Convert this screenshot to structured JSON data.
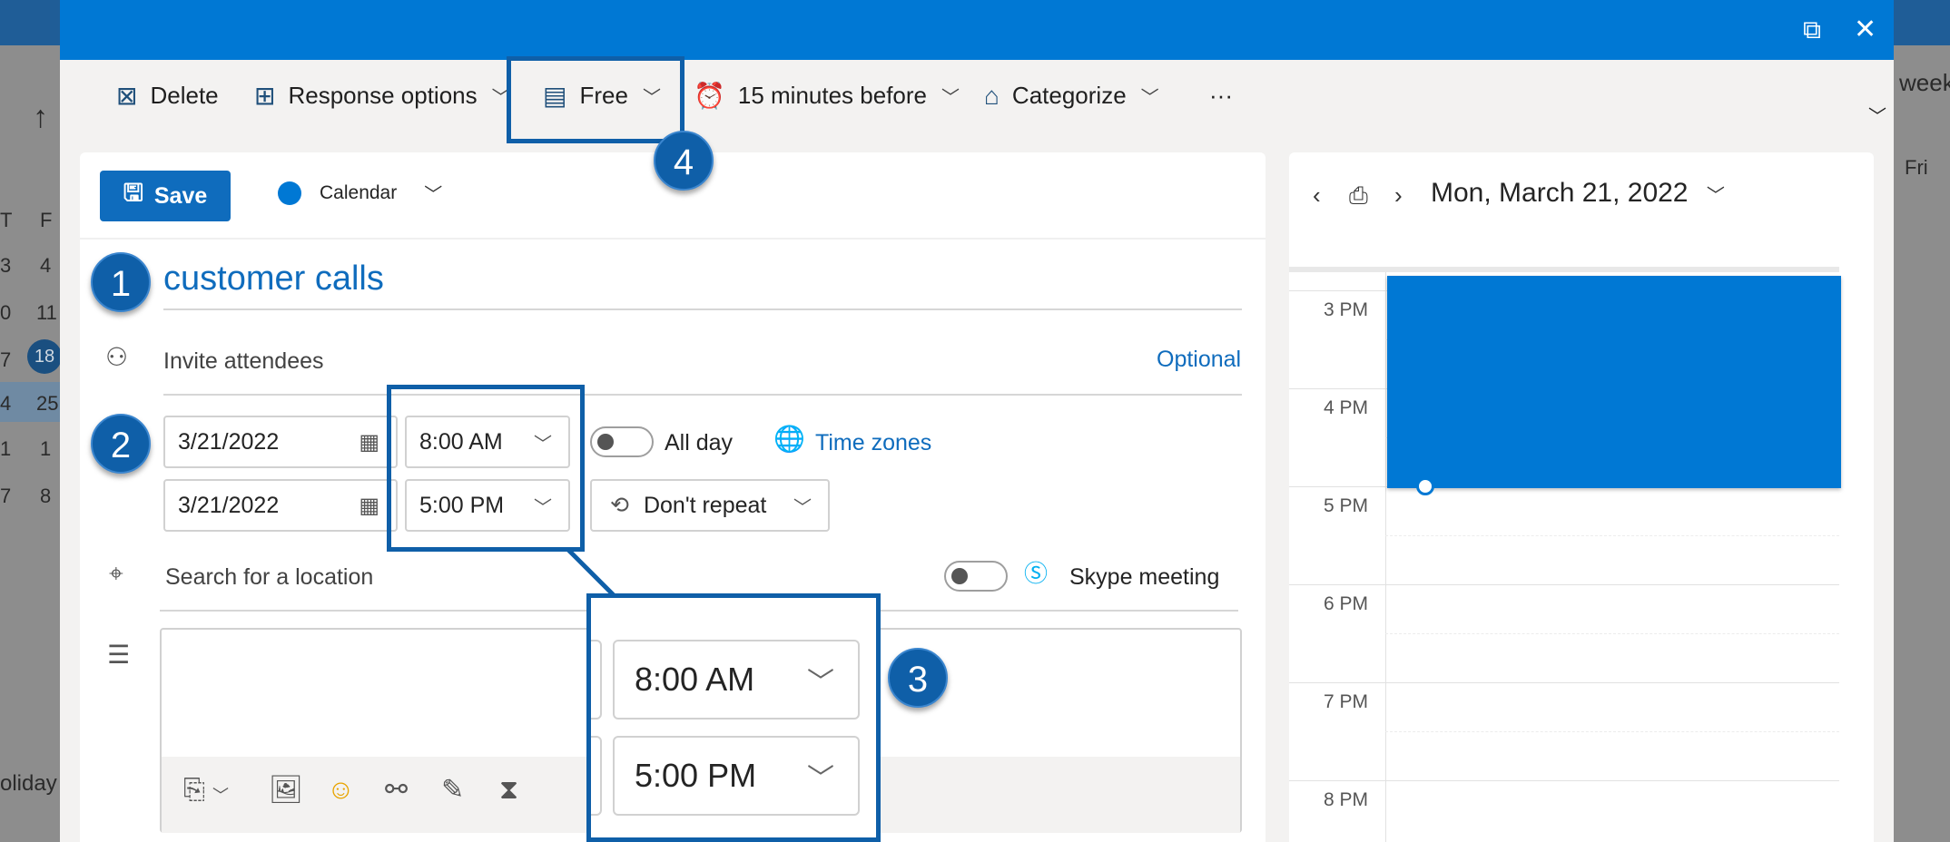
{
  "background": {
    "left_col_headers": [
      "T",
      "F"
    ],
    "left_rows": [
      [
        "3",
        "4"
      ],
      [
        "0",
        "11"
      ],
      [
        "7",
        "18"
      ],
      [
        "4",
        "25"
      ],
      [
        "1",
        "1"
      ],
      [
        "7",
        "8"
      ]
    ],
    "left_footer": "oliday",
    "right_header": "week",
    "right_day": "Fri"
  },
  "toolbar": {
    "delete": "Delete",
    "response_options": "Response options",
    "show_as": "Free",
    "reminder": "15 minutes before",
    "categorize": "Categorize",
    "more": "···"
  },
  "form": {
    "save_label": "Save",
    "calendar_label": "Calendar",
    "title_value": "customer calls",
    "invite_placeholder": "Invite attendees",
    "optional_label": "Optional",
    "start_date": "3/21/2022",
    "start_time": "8:00 AM",
    "end_date": "3/21/2022",
    "end_time": "5:00 PM",
    "all_day_label": "All day",
    "time_zones_label": "Time zones",
    "repeat_label": "Don't repeat",
    "location_placeholder": "Search for a location",
    "skype_label": "Skype meeting"
  },
  "calendar_panel": {
    "date_label": "Mon, March 21, 2022",
    "hours": [
      "3 PM",
      "4 PM",
      "5 PM",
      "6 PM",
      "7 PM",
      "8 PM"
    ]
  },
  "annotations": {
    "badge_1": "1",
    "badge_2": "2",
    "badge_3": "3",
    "badge_4": "4",
    "zoom_start_time": "8:00 AM",
    "zoom_end_time": "5:00 PM"
  },
  "colors": {
    "brand": "#0078d4",
    "annotation": "#0f5fa8"
  }
}
